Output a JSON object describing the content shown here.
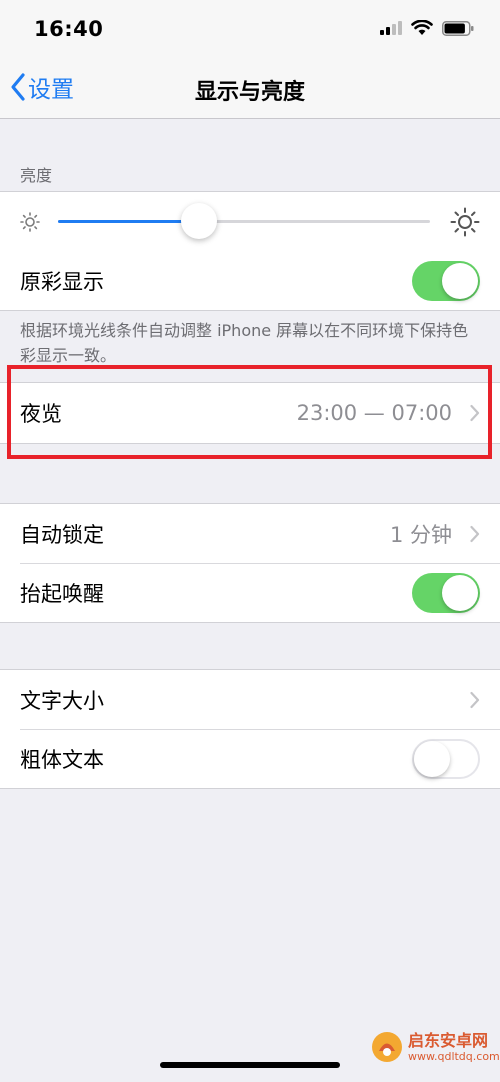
{
  "status": {
    "time": "16:40",
    "battery_level": 0.85
  },
  "nav": {
    "back_label": "设置",
    "title": "显示与亮度"
  },
  "brightness": {
    "section_label": "亮度",
    "level": 0.38
  },
  "true_tone": {
    "label": "原彩显示",
    "on": true,
    "footnote": "根据环境光线条件自动调整 iPhone 屏幕以在不同环境下保持色彩显示一致。"
  },
  "night_shift": {
    "label": "夜览",
    "value": "23:00 — 07:00"
  },
  "auto_lock": {
    "label": "自动锁定",
    "value": "1 分钟"
  },
  "raise_to_wake": {
    "label": "抬起唤醒",
    "on": true
  },
  "text_size": {
    "label": "文字大小"
  },
  "bold_text": {
    "label": "粗体文本",
    "on": false
  },
  "watermark": {
    "text": "启东安卓网",
    "url": "www.qdltdq.com"
  },
  "colors": {
    "accent": "#1f7cf2",
    "toggle_on": "#65d467",
    "highlight": "#e8222a"
  }
}
